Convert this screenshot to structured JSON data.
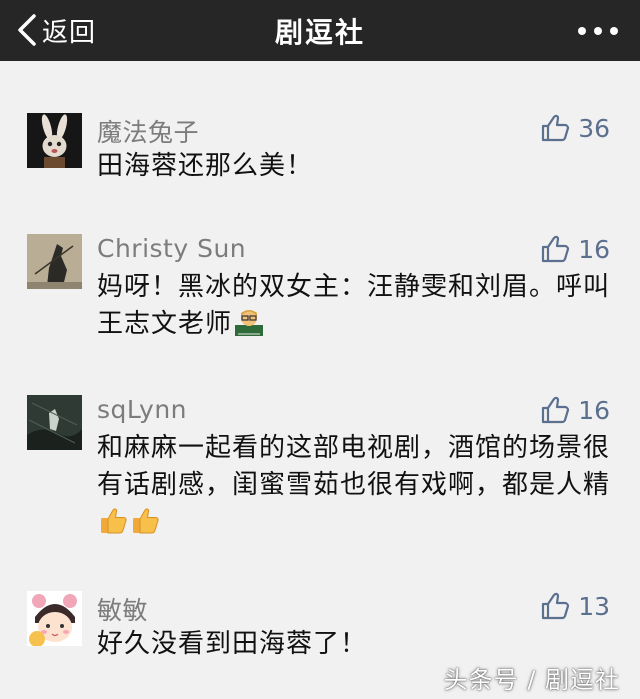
{
  "header": {
    "back_label": "返回",
    "title": "剧逗社"
  },
  "comments": [
    {
      "nickname": "魔法兔子",
      "likes": "36",
      "text": "田海蓉还那么美！",
      "avatar": "rabbit-avatar"
    },
    {
      "nickname": "Christy Sun",
      "likes": "16",
      "text": "妈呀！黑冰的双女主：汪静雯和刘眉。呼叫王志文老师",
      "emoji": [
        "teacher-emoji"
      ],
      "avatar": "figure-avatar"
    },
    {
      "nickname": "sqLynn",
      "likes": "16",
      "text": "和麻麻一起看的这部电视剧，酒馆的场景很有话剧感，闺蜜雪茹也很有戏啊，都是人精",
      "emoji": [
        "thumbs-up-emoji",
        "thumbs-up-emoji"
      ],
      "avatar": "night-avatar"
    },
    {
      "nickname": "敏敏",
      "likes": "13",
      "text": "好久没看到田海蓉了！",
      "avatar": "cartoon-girl-avatar"
    }
  ],
  "watermark": "头条号 / 剧逗社",
  "colors": {
    "navbar": "#262626",
    "background": "#f1f1f1",
    "nickname": "#7c7c7c",
    "like_count": "#5b6f8e",
    "text": "#111111"
  }
}
